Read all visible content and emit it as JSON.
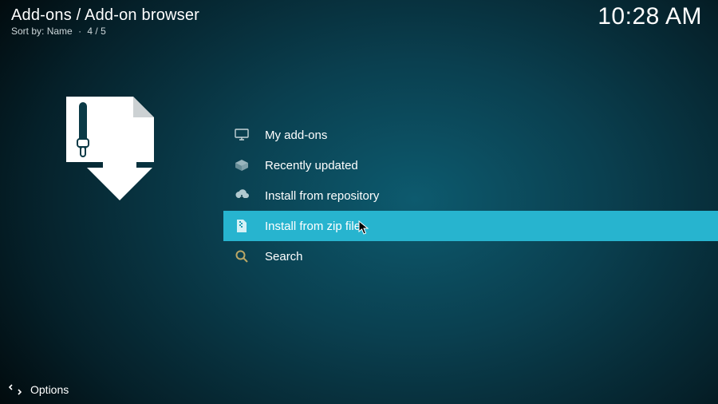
{
  "header": {
    "title": "Add-ons / Add-on browser",
    "sort_prefix": "Sort by:",
    "sort_field": "Name",
    "count": "4 / 5"
  },
  "time": "10:28 AM",
  "menu": {
    "items": [
      {
        "icon": "monitor-icon",
        "label": "My add-ons",
        "selected": false
      },
      {
        "icon": "box-icon",
        "label": "Recently updated",
        "selected": false
      },
      {
        "icon": "cloud-icon",
        "label": "Install from repository",
        "selected": false
      },
      {
        "icon": "zip-icon",
        "label": "Install from zip file",
        "selected": true
      },
      {
        "icon": "search-icon",
        "label": "Search",
        "selected": false
      }
    ]
  },
  "footer": {
    "label": "Options"
  }
}
